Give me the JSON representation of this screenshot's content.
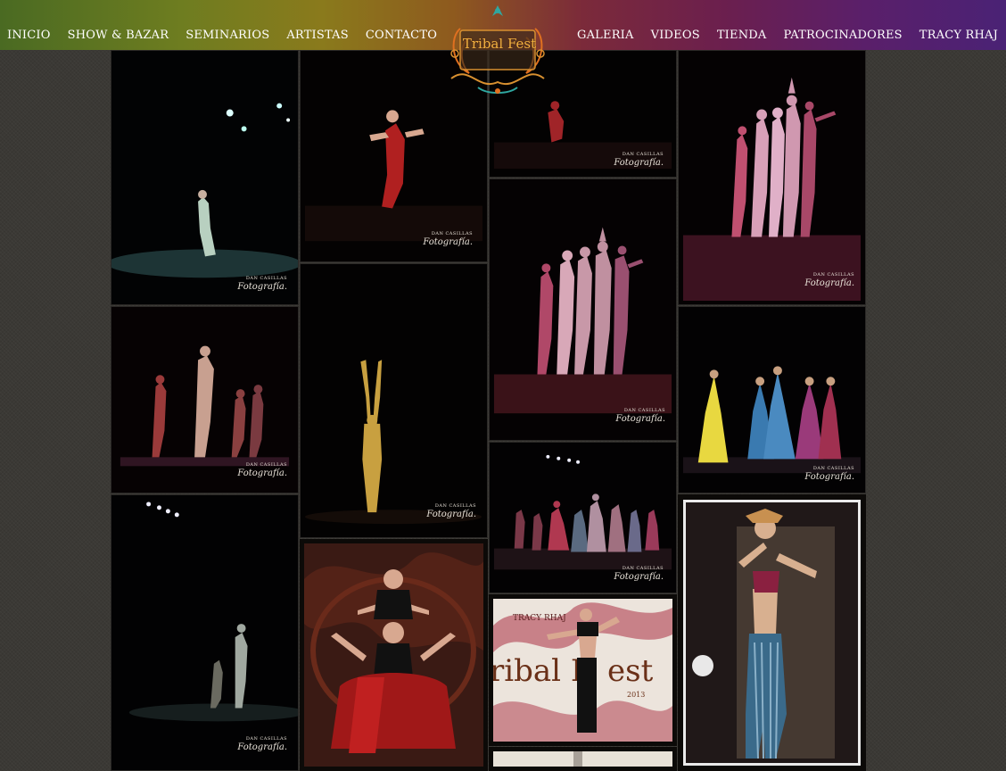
{
  "nav": {
    "left": [
      "INICIO",
      "SHOW & BAZAR",
      "SEMINARIOS",
      "ARTISTAS",
      "CONTACTO"
    ],
    "right": [
      "GALERIA",
      "VIDEOS",
      "TIENDA",
      "PATROCINADORES",
      "TRACY RHAJ"
    ]
  },
  "logo": {
    "text": "Tribal Fest"
  },
  "watermark": {
    "line1": "DAN CASILLAS",
    "line2": "Fotografía."
  },
  "poster_text": {
    "presenter": "TRACY RHAJ",
    "title_a": "ribal F",
    "title_b": "est",
    "year": "2013"
  }
}
